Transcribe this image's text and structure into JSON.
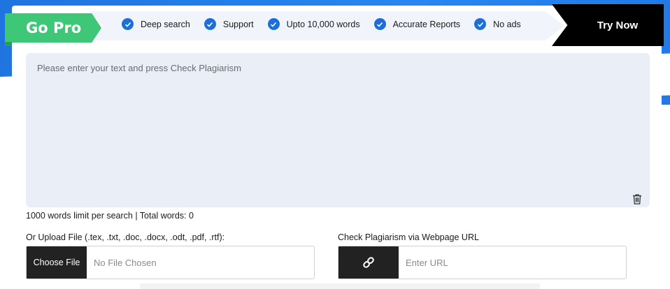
{
  "banner": {
    "go_pro": "Go Pro",
    "features": [
      "Deep search",
      "Support",
      "Upto 10,000 words",
      "Accurate Reports",
      "No ads"
    ],
    "try_now": "Try Now"
  },
  "editor": {
    "placeholder": "Please enter your text and press Check Plagiarism",
    "limit_text": "1000 words limit per search | Total words: 0"
  },
  "upload": {
    "label": "Or Upload File (.tex, .txt, .doc, .docx, .odt, .pdf, .rtf):",
    "button": "Choose File",
    "status": "No File Chosen"
  },
  "url_check": {
    "label": "Check Plagiarism via Webpage URL",
    "placeholder": "Enter URL"
  },
  "colors": {
    "brand_blue": "#1f74e0",
    "go_pro_green": "#3fc778",
    "check_blue": "#1d6fd8"
  }
}
